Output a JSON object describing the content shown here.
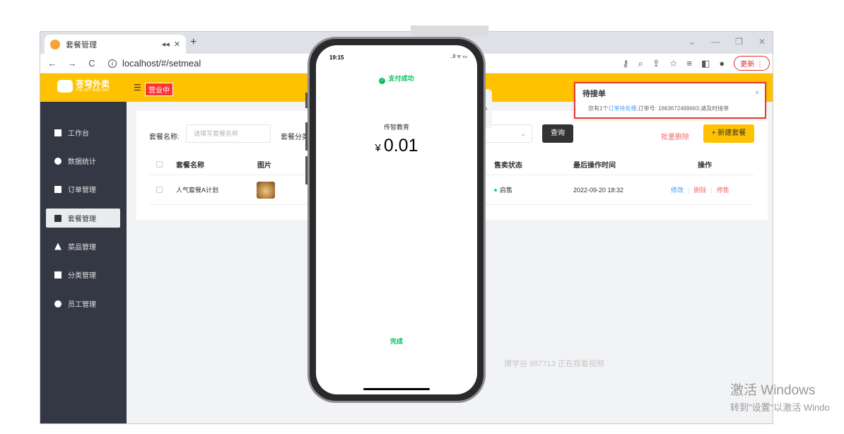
{
  "browser": {
    "tab_title": "套餐管理",
    "new_tab": "+",
    "url": "localhost/#/setmeal",
    "update_label": "更新"
  },
  "app": {
    "logo_text": "苍穹外卖",
    "logo_sub": "THE SKY TAKE-OUT",
    "status": "营业中"
  },
  "sidebar": {
    "items": [
      {
        "label": "工作台"
      },
      {
        "label": "数据统计"
      },
      {
        "label": "订单管理"
      },
      {
        "label": "套餐管理"
      },
      {
        "label": "菜品管理"
      },
      {
        "label": "分类管理"
      },
      {
        "label": "员工管理"
      }
    ],
    "active_index": 3
  },
  "filter": {
    "name_label": "套餐名称:",
    "name_placeholder": "请填写套餐名称",
    "category_label": "套餐分类",
    "query_label": "查询",
    "batch_delete_label": "批量删除",
    "new_label": "+ 新建套餐"
  },
  "table": {
    "headers": [
      "套餐名称",
      "图片",
      "售卖状态",
      "最后操作时间",
      "操作"
    ],
    "rows": [
      {
        "name": "人气套餐A计划",
        "status": "启售",
        "updated": "2022-09-20 18:32",
        "actions": [
          "修改",
          "删除",
          "停售"
        ]
      }
    ]
  },
  "watermark": "博学谷 887713 正在观看视频",
  "notification": {
    "title": "待接单",
    "close": "×",
    "msg_prefix": "您有1个",
    "msg_link": "订单待处理",
    "msg_suffix": ",订单号: 1663672489663,请及时接单"
  },
  "phone": {
    "time": "19:15",
    "status_icons": "..ll ᯤ ▭",
    "success_text": "支付成功",
    "merchant": "传智教育",
    "currency": "¥",
    "amount": "0.01",
    "done_label": "完成"
  },
  "windows": {
    "activate_title": "激活 Windows",
    "activate_sub": "转到\"设置\"以激活 Windo"
  },
  "colors": {
    "brand": "#ffc200",
    "sidebar_bg": "#343744",
    "success": "#07c160",
    "link": "#419eff",
    "danger": "#f56c6c"
  }
}
